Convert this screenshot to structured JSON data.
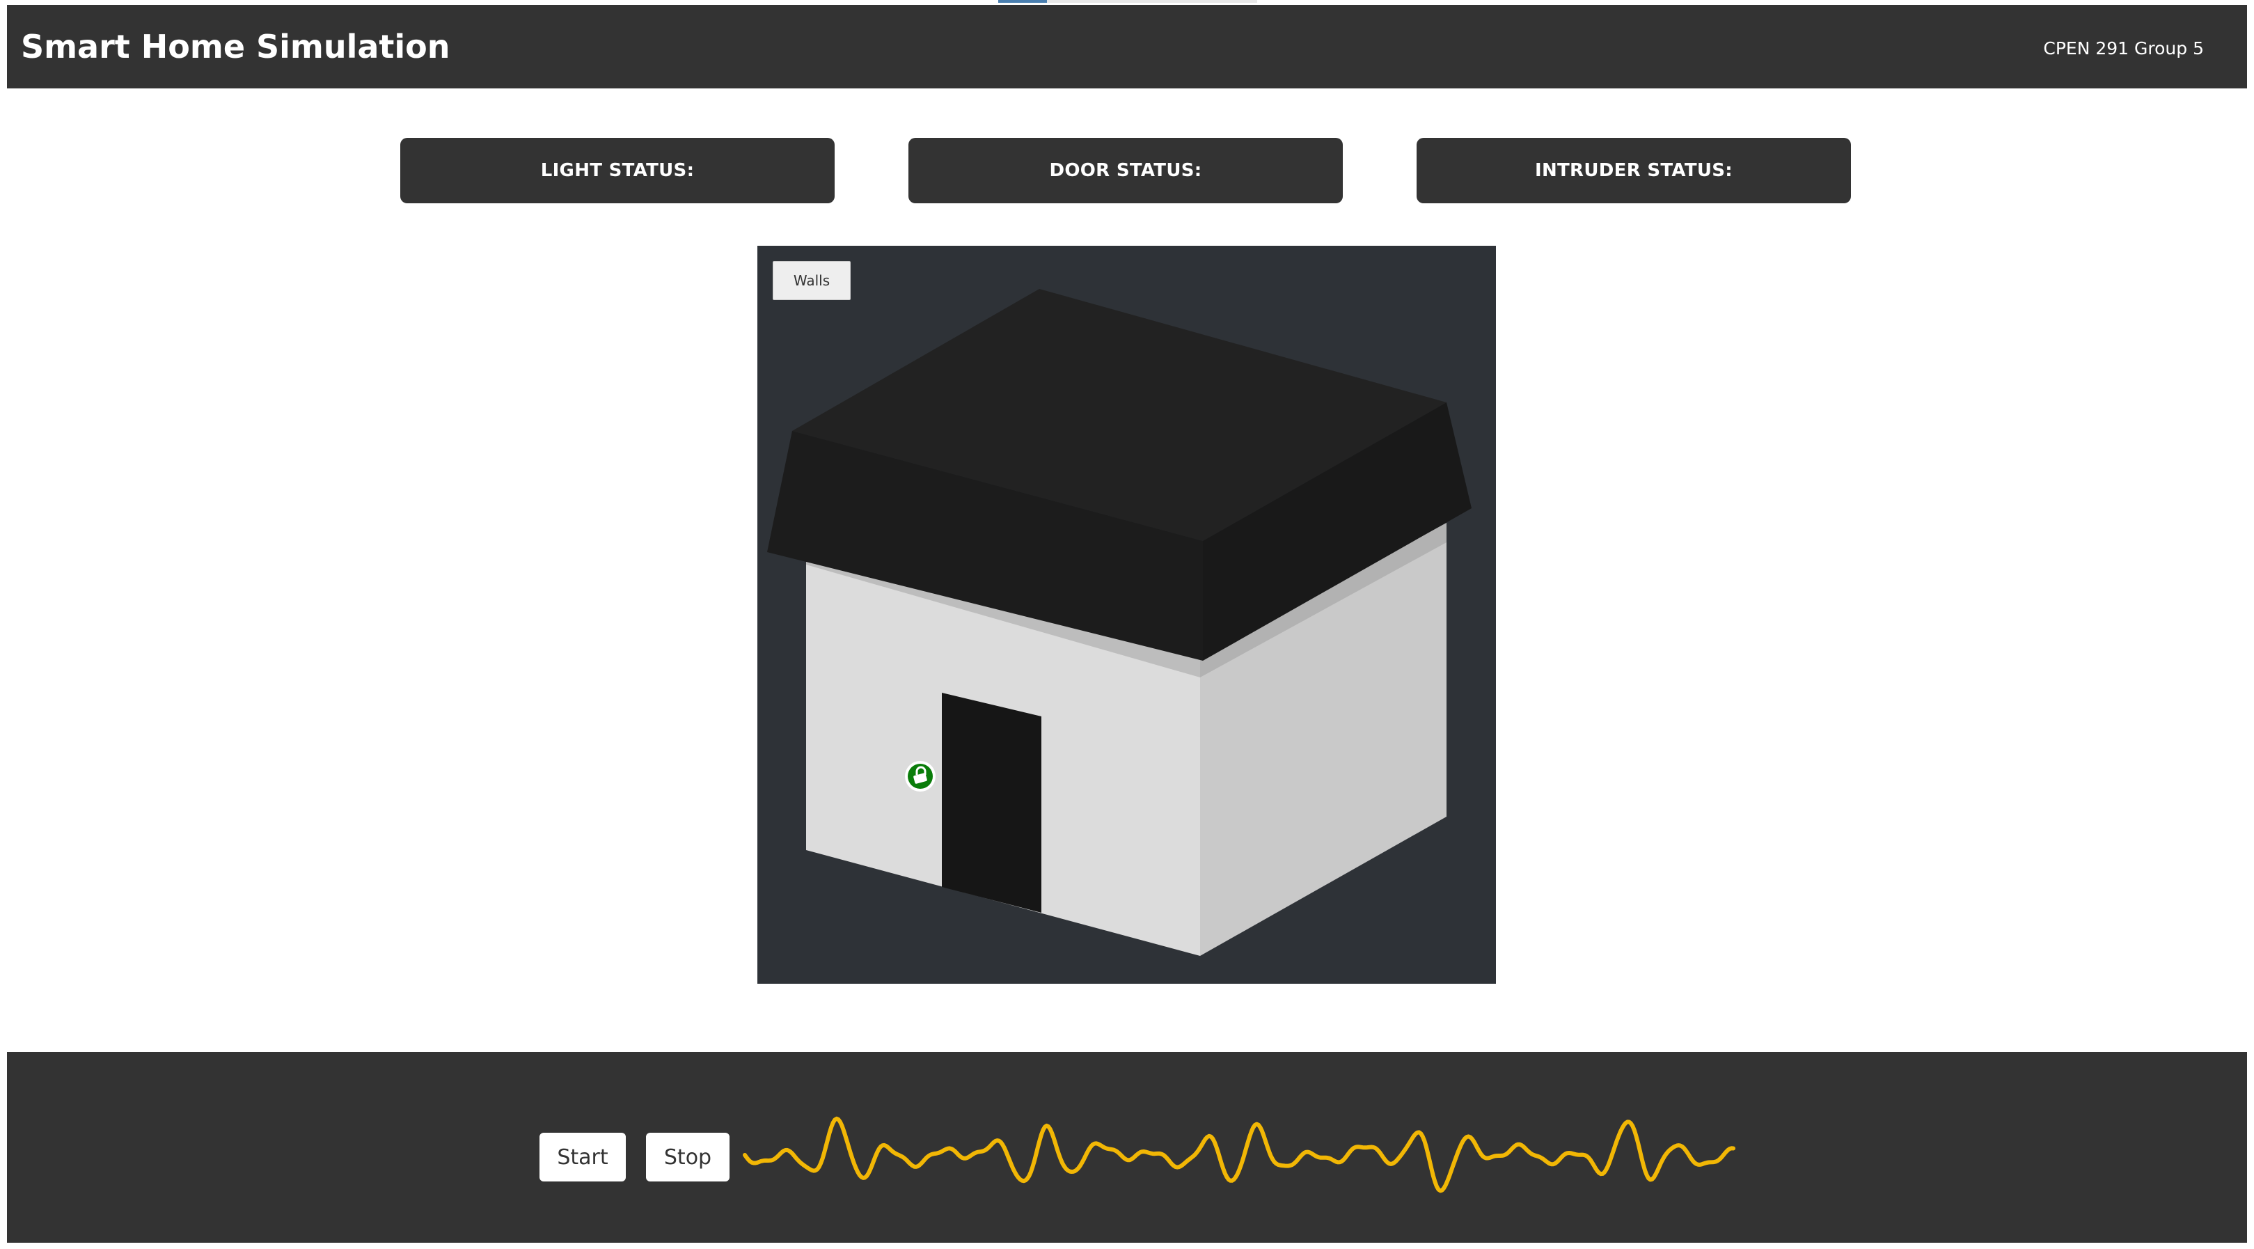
{
  "header": {
    "title": "Smart Home Simulation",
    "group": "CPEN 291 Group 5"
  },
  "status": {
    "light": "LIGHT STATUS:",
    "door": "DOOR STATUS:",
    "intruder": "INTRUDER STATUS:"
  },
  "scene": {
    "walls_button": "Walls",
    "lock_status_color": "#0a7d0a",
    "lock_icon": "lock-icon"
  },
  "controls": {
    "start_label": "Start",
    "stop_label": "Stop"
  },
  "colors": {
    "header_bg": "#333333",
    "scene_bg": "#2e3237",
    "wave": "#f2b705"
  }
}
